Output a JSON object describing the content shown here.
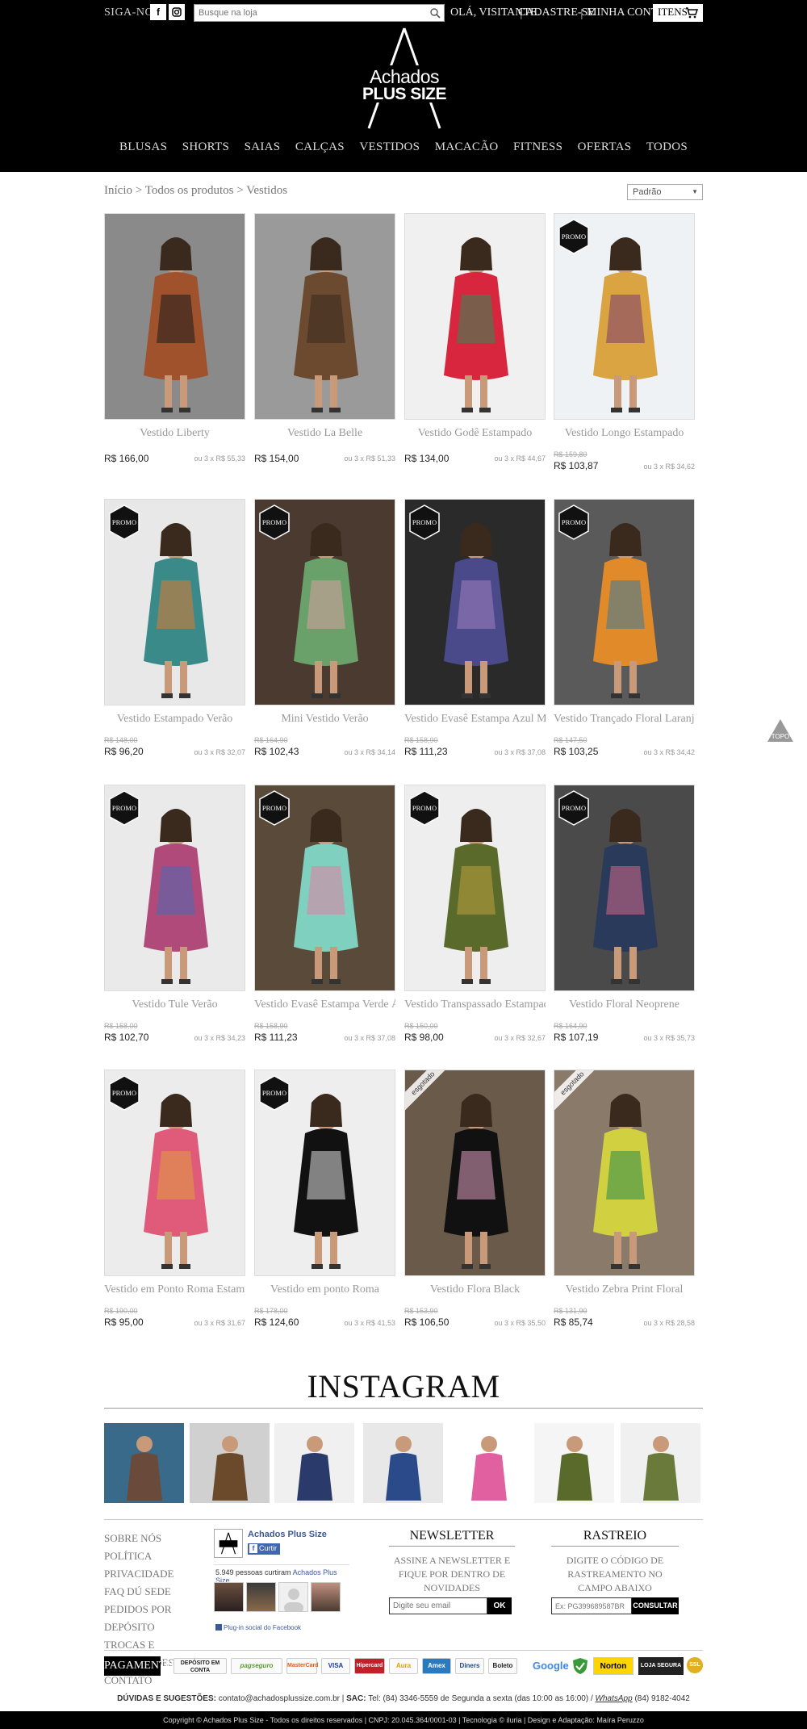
{
  "header": {
    "follow_label": "SIGA-NOS",
    "search_placeholder": "Busque na loja",
    "greeting": "OLÁ, VISITANTE.",
    "signup": "CADASTRE-SE",
    "account": "MINHA CONTA",
    "cart_label": "ITENS",
    "logo_line1": "Achados",
    "logo_line2": "PLUS SIZE"
  },
  "nav": [
    "BLUSAS",
    "SHORTS",
    "SAIAS",
    "CALÇAS",
    "VESTIDOS",
    "MACACÃO",
    "FITNESS",
    "OFERTAS",
    "TODOS"
  ],
  "breadcrumb": {
    "home": "Início",
    "all": "Todos os produtos",
    "current": "Vestidos",
    "sep": ">"
  },
  "sort": {
    "selected": "Padrão"
  },
  "products": [
    {
      "name": "Vestido Liberty",
      "old_price": "",
      "price": "R$ 166,00",
      "installments": "ou 3 x R$ 55,33",
      "badge": "",
      "colors": [
        "#8a8a8a",
        "#a0522d",
        "#1a1a1a"
      ]
    },
    {
      "name": "Vestido La Belle",
      "old_price": "",
      "price": "R$ 154,00",
      "installments": "ou 3 x R$ 51,33",
      "badge": "",
      "colors": [
        "#9a9a9a",
        "#6b4a2f",
        "#3a2a20"
      ]
    },
    {
      "name": "Vestido Godê Estampado",
      "old_price": "",
      "price": "R$ 134,00",
      "installments": "ou 3 x R$ 44,67",
      "badge": "",
      "colors": [
        "#f0f0f0",
        "#d7263d",
        "#2e8b57"
      ]
    },
    {
      "name": "Vestido Longo Estampado",
      "old_price": "R$ 159,80",
      "price": "R$ 103,87",
      "installments": "ou 3 x R$ 34,62",
      "badge": "PROMO",
      "colors": [
        "#eef2f5",
        "#d9a441",
        "#7a3b6e"
      ]
    },
    {
      "name": "Vestido Estampado Verão",
      "old_price": "R$ 148,00",
      "price": "R$ 96,20",
      "installments": "ou 3 x R$ 32,07",
      "badge": "PROMO",
      "colors": [
        "#e8e8e8",
        "#3b8a8a",
        "#e07a2f"
      ]
    },
    {
      "name": "Mini Vestido Verão",
      "old_price": "R$ 164,90",
      "price": "R$ 102,43",
      "installments": "ou 3 x R$ 34,14",
      "badge": "PROMO",
      "colors": [
        "#4a3a30",
        "#6aa06a",
        "#d9a0a0"
      ]
    },
    {
      "name": "Vestido Evasê Estampa Azul Marinho",
      "old_price": "R$ 158,90",
      "price": "R$ 111,23",
      "installments": "ou 3 x R$ 37,08",
      "badge": "PROMO",
      "colors": [
        "#2a2a2a",
        "#4a4a8a",
        "#a080c0"
      ]
    },
    {
      "name": "Vestido Trançado Floral Laranja",
      "old_price": "R$ 147,50",
      "price": "R$ 103,25",
      "installments": "ou 3 x R$ 34,42",
      "badge": "PROMO",
      "colors": [
        "#5a5a5a",
        "#e08a2a",
        "#3a7a9a"
      ]
    },
    {
      "name": "Vestido Tule Verão",
      "old_price": "R$ 158,00",
      "price": "R$ 102,70",
      "installments": "ou 3 x R$ 34,23",
      "badge": "PROMO",
      "colors": [
        "#eaeaea",
        "#b04a7a",
        "#4a6ab0"
      ]
    },
    {
      "name": "Vestido Evasê Estampa Verde Água",
      "old_price": "R$ 158,90",
      "price": "R$ 111,23",
      "installments": "ou 3 x R$ 37,08",
      "badge": "PROMO",
      "colors": [
        "#5a4a3a",
        "#80d0c0",
        "#e080a0"
      ]
    },
    {
      "name": "Vestido Transpassado Estampado",
      "old_price": "R$ 150,00",
      "price": "R$ 98,00",
      "installments": "ou 3 x R$ 32,67",
      "badge": "PROMO",
      "colors": [
        "#eeeeee",
        "#5a6a2a",
        "#c0a040"
      ]
    },
    {
      "name": "Vestido Floral Neoprene",
      "old_price": "R$ 164,90",
      "price": "R$ 107,19",
      "installments": "ou 3 x R$ 35,73",
      "badge": "PROMO",
      "colors": [
        "#4a4a4a",
        "#2a3a5a",
        "#d06a8a"
      ]
    },
    {
      "name": "Vestido em Ponto Roma Estampado",
      "old_price": "R$ 190,00",
      "price": "R$ 95,00",
      "installments": "ou 3 x R$ 31,67",
      "badge": "PROMO",
      "colors": [
        "#ececec",
        "#e05a7a",
        "#e0a040"
      ]
    },
    {
      "name": "Vestido em ponto Roma",
      "old_price": "R$ 178,00",
      "price": "R$ 124,60",
      "installments": "ou 3 x R$ 41,53",
      "badge": "PROMO",
      "colors": [
        "#eeeeee",
        "#111111",
        "#e0e0e0"
      ]
    },
    {
      "name": "Vestido Flora Black",
      "old_price": "R$ 153,90",
      "price": "R$ 106,50",
      "installments": "ou 3 x R$ 35,50",
      "badge": "esgotado",
      "colors": [
        "#6a5a4a",
        "#111111",
        "#e0a0c0"
      ]
    },
    {
      "name": "Vestido Zebra Print Floral",
      "old_price": "R$ 131,90",
      "price": "R$ 85,74",
      "installments": "ou 3 x R$ 28,58",
      "badge": "esgotado",
      "colors": [
        "#8a7a6a",
        "#d0d040",
        "#2a8a4a"
      ]
    }
  ],
  "top_button": "TOPO",
  "instagram": {
    "title": "INSTAGRAM",
    "images": [
      {
        "colors": [
          "#3a6a8a",
          "#6a4a3a"
        ]
      },
      {
        "colors": [
          "#d0d0d0",
          "#6a4a2a"
        ]
      },
      {
        "colors": [
          "#f0f0f0",
          "#2a3a6a"
        ]
      },
      {
        "colors": [
          "#e8e8e8",
          "#2a4a8a"
        ]
      },
      {
        "colors": [
          "#ffffff",
          "#e060a0"
        ]
      },
      {
        "colors": [
          "#f5f5f5",
          "#5a6a2a"
        ]
      },
      {
        "colors": [
          "#f0f0f0",
          "#6a7a3a"
        ]
      }
    ]
  },
  "footer": {
    "links": [
      "SOBRE NÓS",
      "POLÍTICA PRIVACIDADE",
      "FAQ DÚ SEDE",
      "PEDIDOS POR DEPÓSITO",
      "TROCAS E DEVOLUÇÕES",
      "CONTATO"
    ],
    "facebook": {
      "page_name": "Achados Plus Size",
      "like_label": "Curtir",
      "count_text": "5.949 pessoas curtiram",
      "count_page": "Achados Plus Size.",
      "plugin_label": "Plug-in social do Facebook"
    },
    "newsletter": {
      "title": "NEWSLETTER",
      "text": "ASSINE A NEWSLETTER E FIQUE POR DENTRO DE NOVIDADES",
      "placeholder": "Digite seu email",
      "button": "OK"
    },
    "tracking": {
      "title": "RASTREIO",
      "text": "DIGITE O CÓDIGO DE RASTREAMENTO NO CAMPO ABAIXO",
      "placeholder": "Ex: PG399689587BR",
      "button": "CONSULTAR"
    }
  },
  "payment": {
    "label": "PAGAMENTO",
    "methods": [
      "DEPÓSITO EM CONTA",
      "pagseguro",
      "MasterCard",
      "VISA",
      "Hipercard",
      "Aura",
      "Amex",
      "Diners",
      "Boleto"
    ],
    "seals": [
      "Google",
      "Norton",
      "LOJA SEGURA",
      "SSL"
    ]
  },
  "contact": {
    "label": "DÚVIDAS E SUGESTÕES:",
    "email": "contato@achadosplussize.com.br",
    "sac_label": "SAC:",
    "sac": "Tel: (84) 3346-5559 de Segunda a sexta (das 10:00 as 16:00) /",
    "whatsapp_label": "WhatsApp",
    "whatsapp": "(84) 9182-4042"
  },
  "copyright": "Copyright © Achados Plus Size - Todos os direitos reservados | CNPJ: 20.045.364/0001-03 | Tecnologia © iluria | Design e Adaptação: Maíra Peruzzo"
}
